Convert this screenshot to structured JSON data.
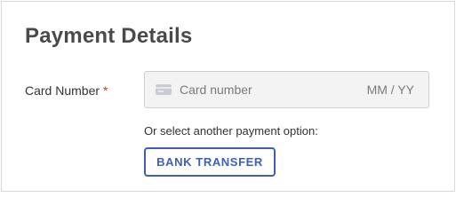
{
  "payment_form": {
    "title": "Payment Details",
    "card_field": {
      "label": "Card Number",
      "required_mark": "*",
      "icon": "credit-card-icon",
      "card_placeholder": "Card number",
      "expiry_placeholder": "MM / YY"
    },
    "alternative_text": "Or select another payment option:",
    "bank_transfer_button": "BANK TRANSFER"
  },
  "colors": {
    "title": "#4a4a4a",
    "required": "#d0352c",
    "input_background": "#f3f3f3",
    "button_accent": "#3f5fb5",
    "border": "#d9d9d9"
  }
}
